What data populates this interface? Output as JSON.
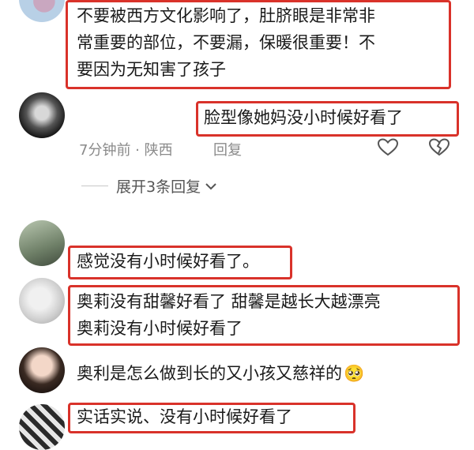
{
  "comments": [
    {
      "text_lines": [
        "不要被西方文化影响了，肚脐眼是非常非",
        "常重要的部位，不要漏，保暖很重要！不",
        "要因为无知害了孩子"
      ]
    },
    {
      "text_lines": [
        "脸型像她妈没小时候好看了"
      ],
      "time": "7分钟前",
      "location": "陕西",
      "reply_label": "回复"
    },
    {
      "text_lines": [
        "感觉没有小时候好看了。"
      ]
    },
    {
      "text_lines": [
        "奥莉没有甜馨好看了   甜馨是越长大越漂亮",
        "奥莉没有小时候好看了"
      ]
    },
    {
      "text_lines": [
        "奥利是怎么做到长的又小孩又慈祥的"
      ],
      "emoji": "🥺"
    },
    {
      "text_lines": [
        "实话实说、没有小时候好看了"
      ]
    }
  ],
  "replies_expand": "展开3条回复",
  "colors": {
    "highlight_border": "#d9322a",
    "meta_text": "#8a8a8a"
  },
  "icons": [
    "heart-icon",
    "dislike-heart-icon",
    "chevron-down-icon"
  ]
}
